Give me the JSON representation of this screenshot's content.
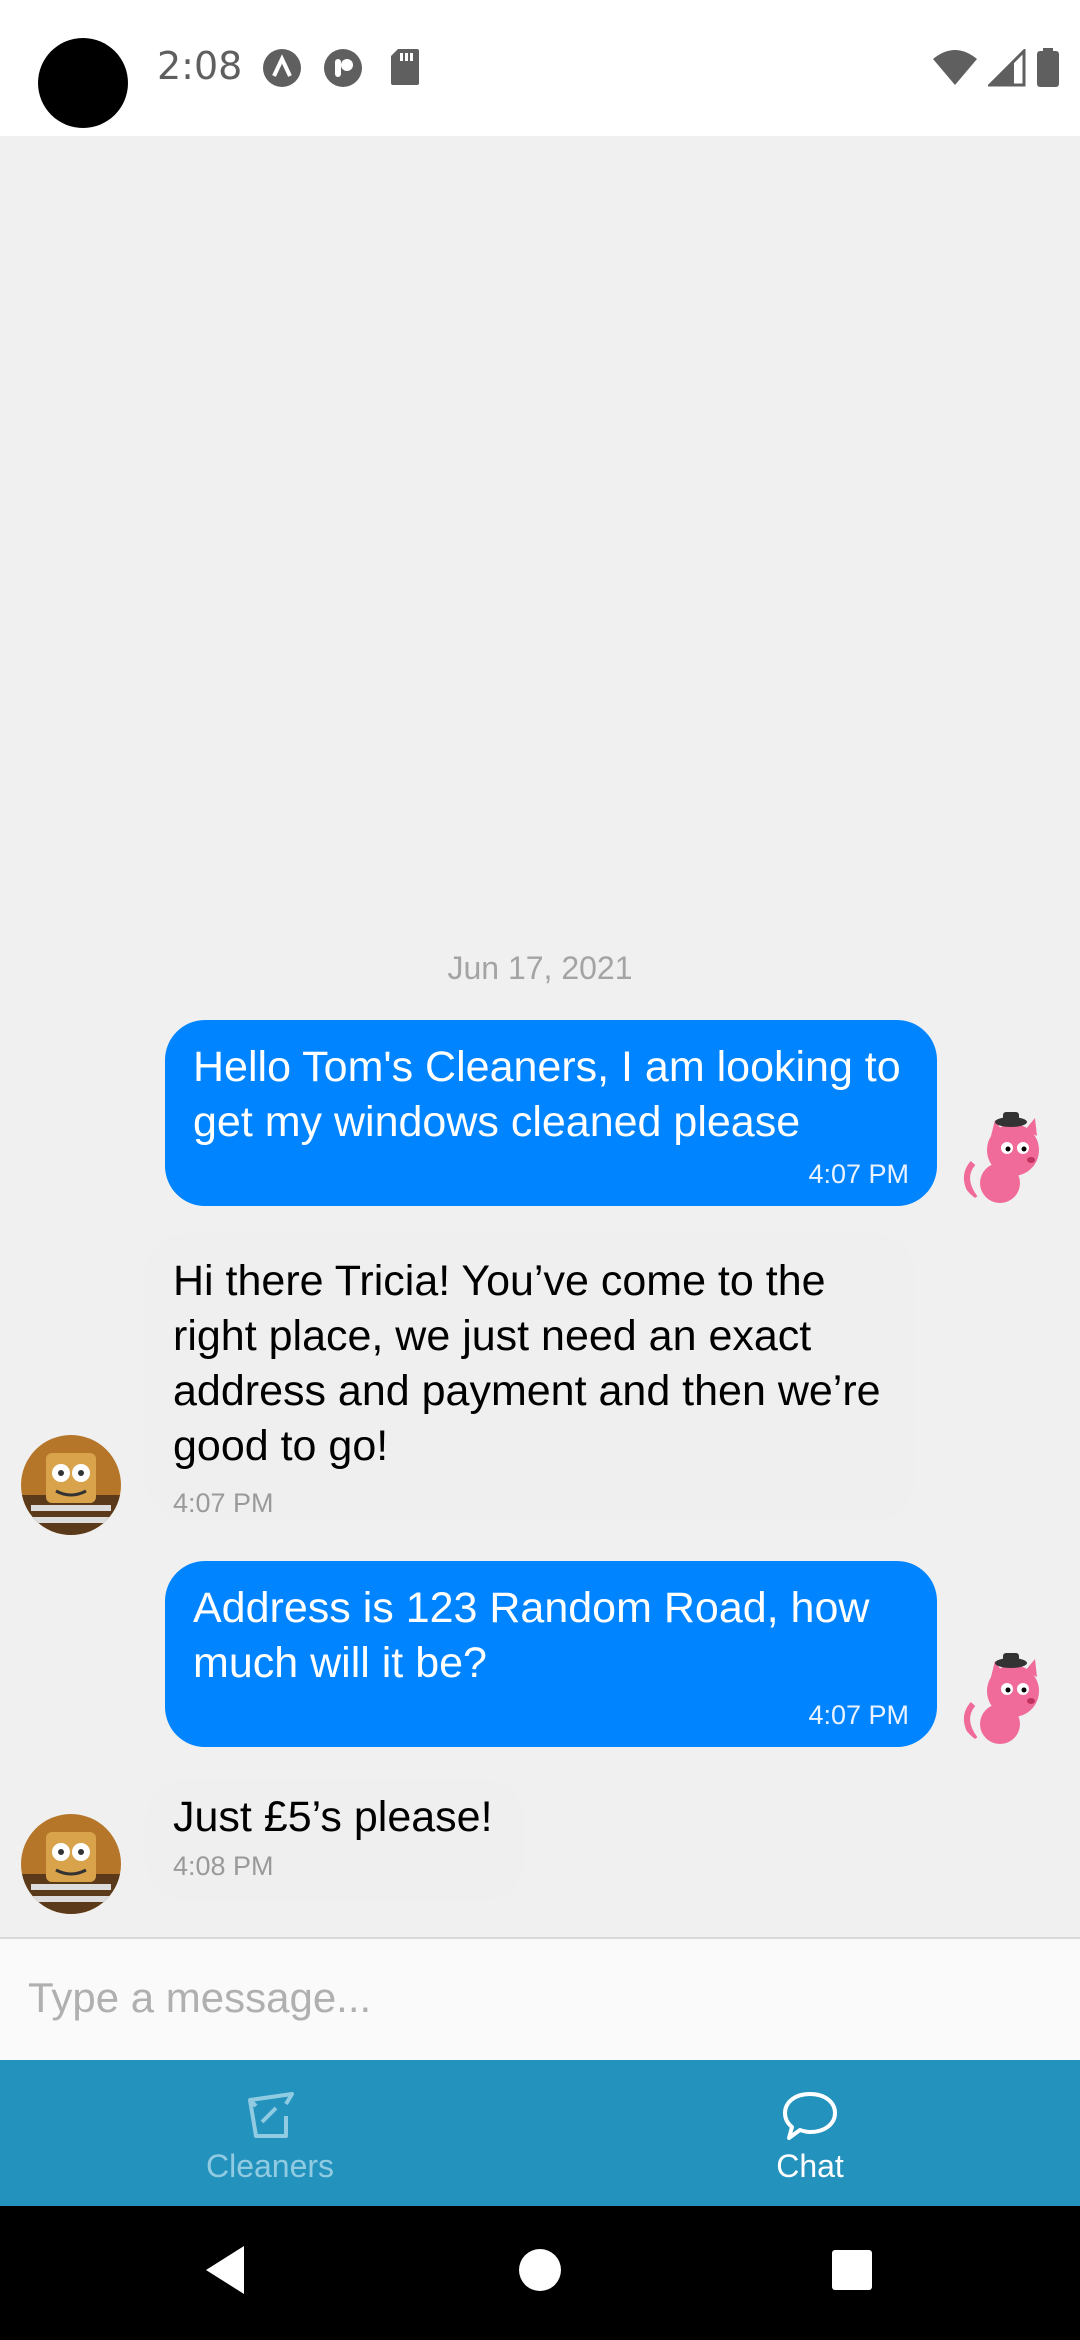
{
  "status_bar": {
    "time": "2:08",
    "icons_left": [
      "app-a-icon",
      "app-p-icon",
      "sd-card-icon"
    ],
    "icons_right": [
      "wifi-icon",
      "signal-icon",
      "battery-icon"
    ]
  },
  "chat": {
    "date_separator": "Jun 17, 2021",
    "messages": [
      {
        "direction": "outgoing",
        "text": "Hello Tom's Cleaners, I am looking to get my windows cleaned please",
        "time": "4:07 PM"
      },
      {
        "direction": "incoming",
        "text": "Hi there Tricia! You’ve come to the right place, we just need an exact address and payment and then we’re good to go!",
        "time": "4:07 PM"
      },
      {
        "direction": "outgoing",
        "text": "Address is 123 Random Road, how much will it be?",
        "time": "4:07 PM"
      },
      {
        "direction": "incoming",
        "text": "Just £5’s please!",
        "time": "4:08 PM"
      }
    ]
  },
  "composer": {
    "placeholder": "Type a message..."
  },
  "tabs": [
    {
      "label": "Cleaners",
      "icon": "cleaners-icon",
      "active": false
    },
    {
      "label": "Chat",
      "icon": "chat-bubble-icon",
      "active": true
    }
  ],
  "colors": {
    "outgoing_bubble": "#0084ff",
    "incoming_bubble": "#efefef",
    "tab_bar": "#2392bd"
  }
}
